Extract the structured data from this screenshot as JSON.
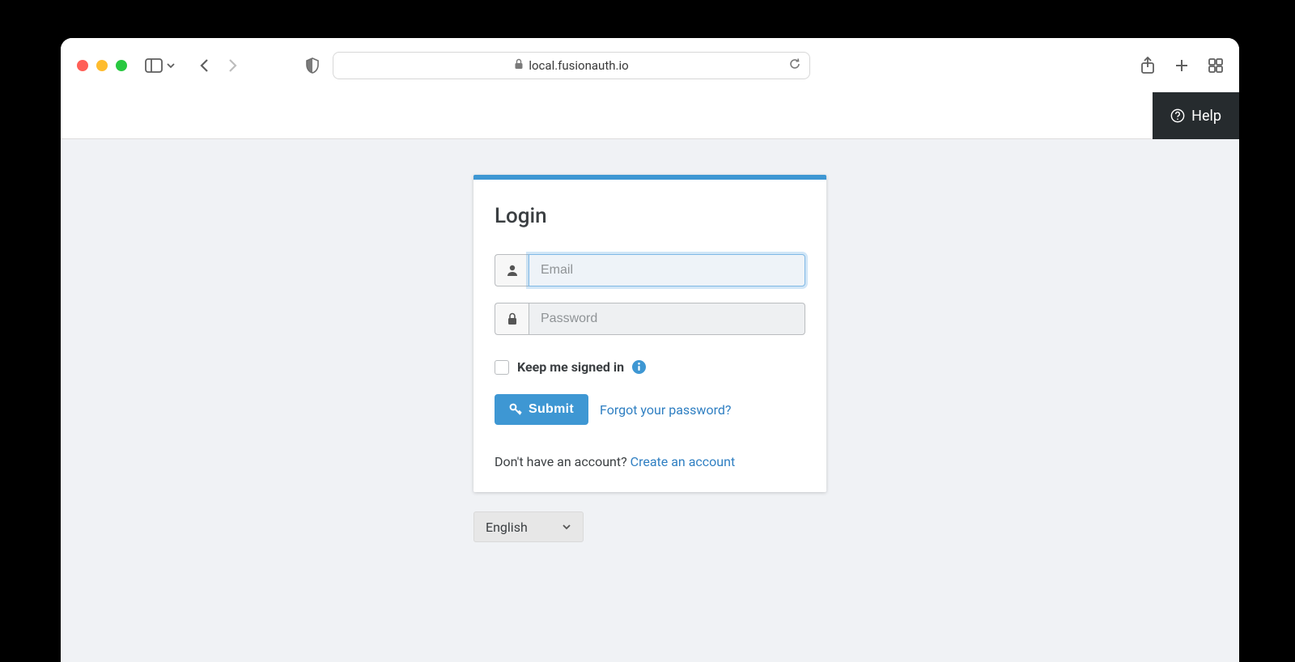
{
  "browser": {
    "url_host": "local.fusionauth.io"
  },
  "header": {
    "help_label": "Help"
  },
  "login": {
    "title": "Login",
    "email_placeholder": "Email",
    "email_value": "",
    "password_placeholder": "Password",
    "password_value": "",
    "remember_label": "Keep me signed in",
    "submit_label": "Submit",
    "forgot_link": "Forgot your password?",
    "signup_prompt": "Don't have an account? ",
    "signup_link": "Create an account"
  },
  "language": {
    "selected": "English"
  },
  "colors": {
    "accent": "#3e97d3",
    "header_dark": "#262b2e",
    "page_bg": "#f0f2f5"
  }
}
